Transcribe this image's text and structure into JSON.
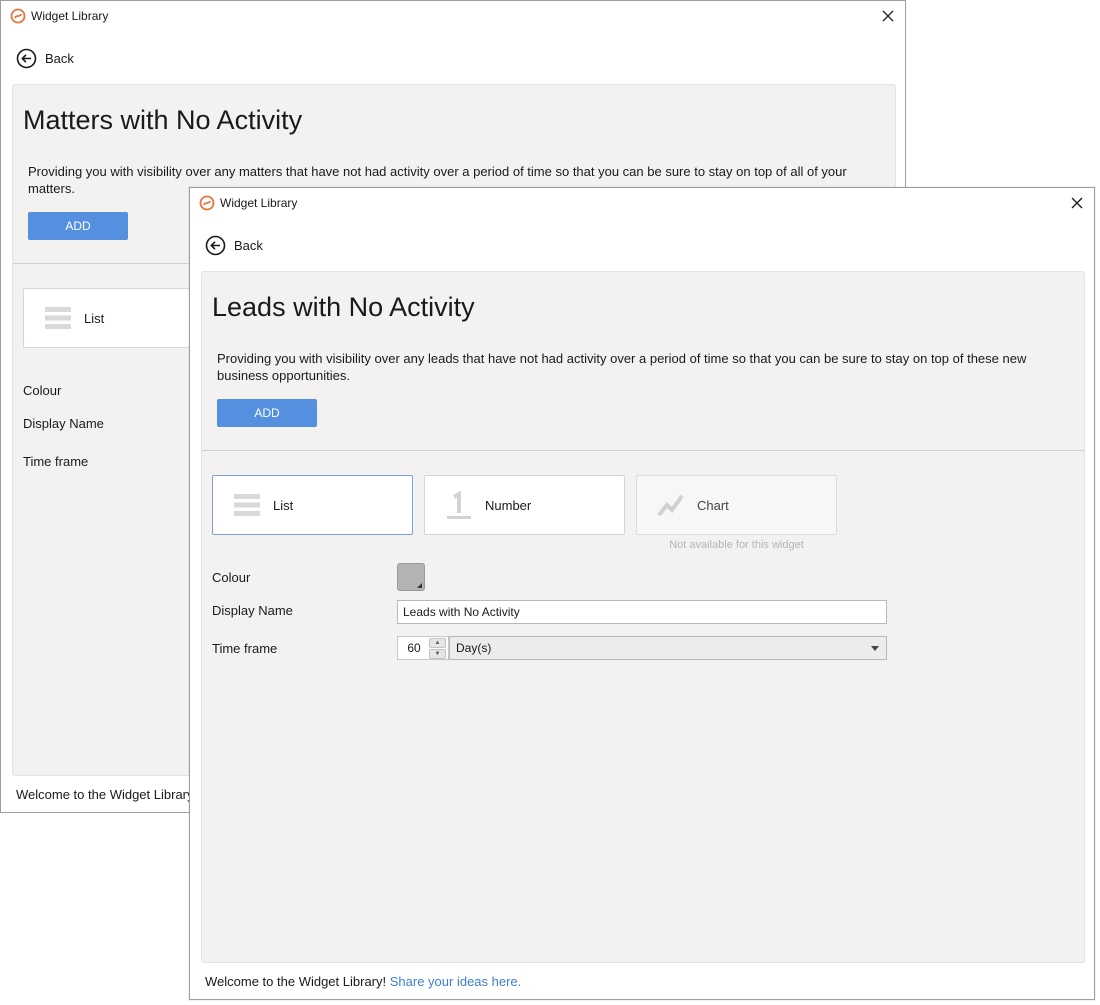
{
  "back_window": {
    "title": "Widget Library",
    "back_label": "Back",
    "heading": "Matters with No Activity",
    "description": "Providing you with visibility over any matters that have not had activity over a period of time so that you can be sure to stay on top of all of your matters.",
    "add_label": "ADD",
    "card_list_label": "List",
    "colour_label": "Colour",
    "display_name_label": "Display Name",
    "time_frame_label": "Time frame",
    "footer_text": "Welcome to the Widget Library"
  },
  "front_window": {
    "title": "Widget Library",
    "back_label": "Back",
    "heading": "Leads with No Activity",
    "description": "Providing you with visibility over any leads that have not had activity over a period of time so that you can be sure to stay on top of these new business opportunities.",
    "add_label": "ADD",
    "widget_types": [
      {
        "label": "List",
        "icon": "list-icon",
        "state": "selected"
      },
      {
        "label": "Number",
        "icon": "number-icon",
        "state": "enabled"
      },
      {
        "label": "Chart",
        "icon": "chart-icon",
        "state": "disabled"
      }
    ],
    "chart_note": "Not available for this widget",
    "colour_label": "Colour",
    "colour_value": "#b3b3b3",
    "display_name_label": "Display Name",
    "display_name_value": "Leads with No Activity",
    "time_frame_label": "Time frame",
    "time_frame_number": "60",
    "time_frame_unit": "Day(s)",
    "footer_text": "Welcome to the Widget Library!",
    "footer_link": "Share your ideas here."
  },
  "colors": {
    "accent": "#5590e0",
    "panel_bg": "#f3f2f1",
    "link": "#3f7fcf",
    "logo": "#e8743b"
  }
}
